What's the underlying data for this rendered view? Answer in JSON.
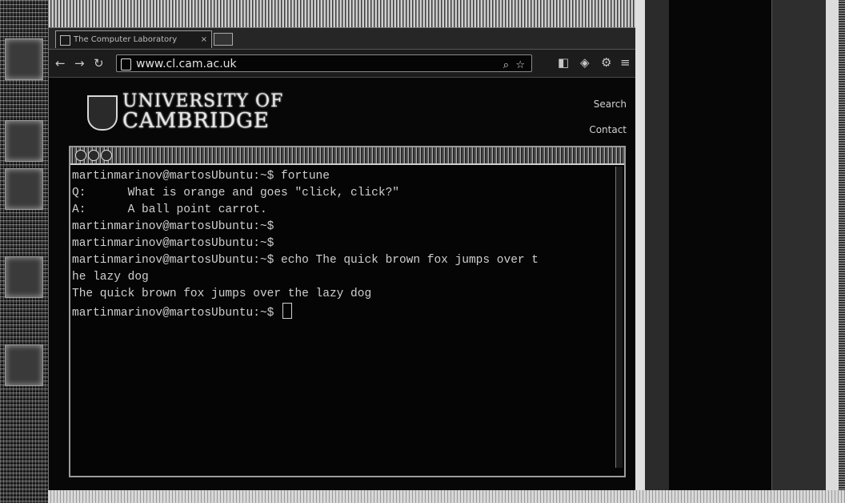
{
  "browser": {
    "tab_title": "The Computer Laboratory",
    "tab_close": "×",
    "url": "www.cl.cam.ac.uk",
    "nav": {
      "back": "←",
      "forward": "→",
      "reload": "↻"
    },
    "toolbar_icons": {
      "search": "⌕",
      "star": "☆",
      "settings": "⚙",
      "menu": "≡"
    }
  },
  "page": {
    "logo_line1": "UNIVERSITY OF",
    "logo_line2": "CAMBRIDGE",
    "link_search": "Search",
    "link_contact": "Contact"
  },
  "terminal": {
    "lines": [
      "martinmarinov@martosUbuntu:~$ fortune",
      "Q:      What is orange and goes \"click, click?\"",
      "A:      A ball point carrot.",
      "martinmarinov@martosUbuntu:~$",
      "martinmarinov@martosUbuntu:~$",
      "martinmarinov@martosUbuntu:~$ echo The quick brown fox jumps over t",
      "he lazy dog",
      "The quick brown fox jumps over the lazy dog"
    ],
    "prompt": "martinmarinov@martosUbuntu:~$ "
  }
}
